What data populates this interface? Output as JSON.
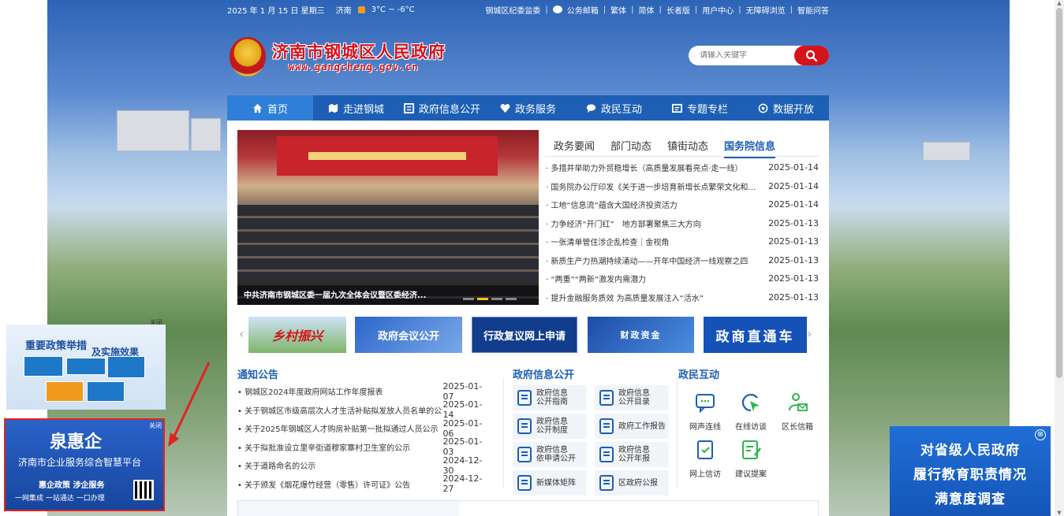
{
  "topbar": {
    "date": "2025 年 1 月 15 日 星期三",
    "city": "济南",
    "temp": "3°C ~ -6°C",
    "links": [
      "钢城区纪委监委",
      "公务邮箱",
      "繁体",
      "简体",
      "长者版",
      "用户中心",
      "无障碍浏览",
      "智能问答"
    ]
  },
  "header": {
    "title": "济南市钢城区人民政府",
    "url": "www.gangcheng.gov.cn"
  },
  "search": {
    "placeholder": "请输入关键字"
  },
  "nav": [
    "首页",
    "走进钢城",
    "政府信息公开",
    "政务服务",
    "政民互动",
    "专题专栏",
    "数据开放"
  ],
  "slider": {
    "caption": "中共济南市钢城区委一届九次全体会议暨区委经济..."
  },
  "news_tabs": [
    "政务要闻",
    "部门动态",
    "镇街动态",
    "国务院信息"
  ],
  "news": [
    {
      "title": "多措并举助力外贸稳增长（高质量发展看亮点·走一线）",
      "date": "2025-01-14"
    },
    {
      "title": "国务院办公厅印发《关于进一步培育新增长点繁荣文化和旅...",
      "date": "2025-01-14"
    },
    {
      "title": "工地“信息流”蕴含大国经济投资活力",
      "date": "2025-01-14"
    },
    {
      "title": "力争经济“开门红”　地方部署聚焦三大方向",
      "date": "2025-01-13"
    },
    {
      "title": "一张清单管住涉企乱检查｜金视角",
      "date": "2025-01-13"
    },
    {
      "title": "新质生产力热潮持续涌动——开年中国经济一线观察之四",
      "date": "2025-01-13"
    },
    {
      "title": "“两重”“两新”激发内需潜力",
      "date": "2025-01-13"
    },
    {
      "title": "提升金融服务质效 为高质量发展注入“活水”",
      "date": "2025-01-13"
    }
  ],
  "banners": [
    "乡村振兴",
    "政府会议公开",
    "行政复议网上申请",
    "财政资金",
    "政商直通车"
  ],
  "notice": {
    "title": "通知公告",
    "items": [
      {
        "title": "钢城区2024年度政府网站工作年度报表",
        "date": "2025-01-07"
      },
      {
        "title": "关于钢城区市级高层次人才生活补贴拟发放人员名单的公示",
        "date": "2025-01-14"
      },
      {
        "title": "关于2025年钢城区人才购房补贴第一批拟通过人员公示",
        "date": "2025-01-06"
      },
      {
        "title": "关于拟批准设立里辛街道穆家寨村卫生室的公示",
        "date": "2025-01-03"
      },
      {
        "title": "关于道路命名的公示",
        "date": "2024-12-30"
      },
      {
        "title": "关于颁发《烟花爆竹经营（零售）许可证》公告",
        "date": "2024-12-27"
      }
    ]
  },
  "gov_info": {
    "title": "政府信息公开",
    "items": [
      {
        "l1": "政府信息",
        "l2": "公开指南"
      },
      {
        "l1": "政府信息",
        "l2": "公开目录"
      },
      {
        "l1": "政府信息",
        "l2": "公开制度"
      },
      {
        "l1": "政府工作报告",
        "l2": ""
      },
      {
        "l1": "政府信息",
        "l2": "依申请公开"
      },
      {
        "l1": "政府信息",
        "l2": "公开年报"
      },
      {
        "l1": "新媒体矩阵",
        "l2": ""
      },
      {
        "l1": "区政府公报",
        "l2": ""
      }
    ]
  },
  "interaction": {
    "title": "政民互动",
    "items": [
      "网声连线",
      "在线访谈",
      "区长信箱",
      "网上信访",
      "建议提案"
    ]
  },
  "float_left_top": {
    "close": "关闭",
    "title1": "重要政策举措",
    "title2": "及实施效果"
  },
  "float_left_bottom": {
    "close": "关闭",
    "logo": "泉惠企",
    "subtitle": "济南市企业服务综合智慧平台",
    "slogan": "惠企政策 涉企服务",
    "slogan2": "一网集成 一站通达 一口办理"
  },
  "float_right": {
    "close": "⊗",
    "lines": [
      "对省级人民政府",
      "履行教育职责情况",
      "满意度调查"
    ]
  },
  "colors": {
    "primary": "#1d5fb4",
    "accent": "#d6121b"
  }
}
